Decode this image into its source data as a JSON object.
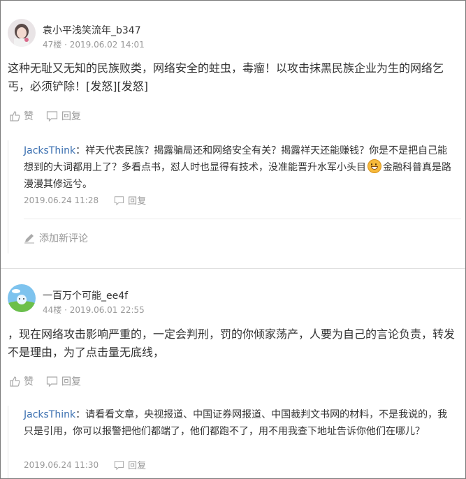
{
  "posts": [
    {
      "username": "袁小平浅笑流年_b347",
      "meta": "47楼 · 2019.06.02 14:01",
      "content": "这种无耻又无知的民族败类，网络安全的蛀虫，毒瘤！以攻击抹黑民族企业为生的网络乞丐，必须铲除！[发怒][发怒]",
      "like_label": "赞",
      "reply_label": "回复",
      "reply": {
        "user": "JacksThink",
        "sep": "：",
        "text_before_emoji": "祥天代表民族？揭露骗局还和网络安全有关？揭露祥天还能赚钱？你是不是把自己能想到的大词都用上了？多看点书，怼人时也显得有技术，没准能晋升水军小头目",
        "text_after_emoji": "金融科普真是路漫漫其修远兮。",
        "time": "2019.06.24 11:28",
        "reply_label": "回复"
      },
      "add_comment_label": "添加新评论"
    },
    {
      "username": "一百万个可能_ee4f",
      "meta": "44楼 · 2019.06.01 22:55",
      "content": "，现在网络攻击影响严重的，一定会判刑，罚的你倾家荡产，人要为自己的言论负责，转发不是理由，为了点击量无底线，",
      "like_label": "赞",
      "reply_label": "回复",
      "reply": {
        "user": "JacksThink",
        "sep": "：",
        "text": "请看看文章，央视报道、中国证券网报道、中国裁判文书网的材料，不是我说的，我只是引用，你可以报警把他们都端了，他们都跑不了，用不用我查下地址告诉你他们在哪儿？",
        "time": "2019.06.24 11:30",
        "reply_label": "回复"
      }
    }
  ]
}
